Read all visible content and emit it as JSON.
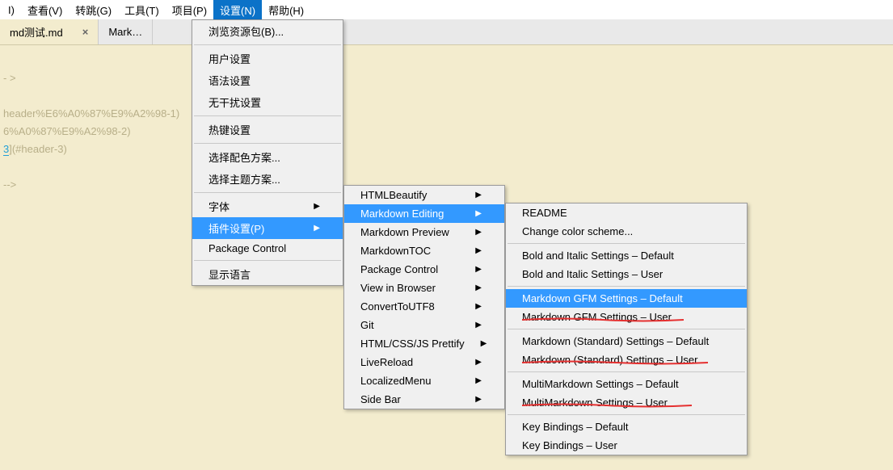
{
  "menubar": [
    {
      "label": "I)"
    },
    {
      "label": "查看(V)"
    },
    {
      "label": "转跳(G)"
    },
    {
      "label": "工具(T)"
    },
    {
      "label": "项目(P)"
    },
    {
      "label": "设置(N)",
      "active": true
    },
    {
      "label": "帮助(H)"
    }
  ],
  "tabs": [
    {
      "label": "md测试.md",
      "active": true,
      "close": "×"
    },
    {
      "label": "Mark…"
    }
  ],
  "editor": {
    "l1": "- >",
    "l2a": "header%E6%A0%87%E9%A2%98-1)",
    "l2b": "6%A0%87%E9%A2%98-2)",
    "l3_pre": "3",
    "l3_link": "](#header-3)",
    "l4": "-->"
  },
  "menu1": [
    {
      "type": "item",
      "label": "浏览资源包(B)..."
    },
    {
      "type": "sep"
    },
    {
      "type": "item",
      "label": "用户设置"
    },
    {
      "type": "item",
      "label": "语法设置"
    },
    {
      "type": "item",
      "label": "无干扰设置"
    },
    {
      "type": "sep"
    },
    {
      "type": "item",
      "label": "热键设置"
    },
    {
      "type": "sep"
    },
    {
      "type": "item",
      "label": "选择配色方案..."
    },
    {
      "type": "item",
      "label": "选择主题方案..."
    },
    {
      "type": "sep"
    },
    {
      "type": "item",
      "label": "字体",
      "sub": true
    },
    {
      "type": "item",
      "label": "插件设置(P)",
      "sub": true,
      "hi": true
    },
    {
      "type": "item",
      "label": "Package Control"
    },
    {
      "type": "sep"
    },
    {
      "type": "item",
      "label": "显示语言"
    }
  ],
  "menu2": [
    {
      "type": "item",
      "label": "HTMLBeautify",
      "sub": true
    },
    {
      "type": "item",
      "label": "Markdown Editing",
      "sub": true,
      "hi": true
    },
    {
      "type": "item",
      "label": "Markdown Preview",
      "sub": true
    },
    {
      "type": "item",
      "label": "MarkdownTOC",
      "sub": true
    },
    {
      "type": "item",
      "label": "Package Control",
      "sub": true
    },
    {
      "type": "item",
      "label": "View in Browser",
      "sub": true
    },
    {
      "type": "item",
      "label": "ConvertToUTF8",
      "sub": true
    },
    {
      "type": "item",
      "label": "Git",
      "sub": true
    },
    {
      "type": "item",
      "label": "HTML/CSS/JS Prettify",
      "sub": true
    },
    {
      "type": "item",
      "label": "LiveReload",
      "sub": true
    },
    {
      "type": "item",
      "label": "LocalizedMenu",
      "sub": true
    },
    {
      "type": "item",
      "label": "Side Bar",
      "sub": true
    }
  ],
  "menu3": [
    {
      "type": "item",
      "label": "README"
    },
    {
      "type": "item",
      "label": "Change color scheme..."
    },
    {
      "type": "sep"
    },
    {
      "type": "item",
      "label": "Bold and Italic Settings – Default"
    },
    {
      "type": "item",
      "label": "Bold and Italic Settings – User"
    },
    {
      "type": "sep"
    },
    {
      "type": "item",
      "label": "Markdown GFM Settings – Default",
      "hi": true
    },
    {
      "type": "item",
      "label": "Markdown GFM Settings – User"
    },
    {
      "type": "sep"
    },
    {
      "type": "item",
      "label": "Markdown (Standard) Settings – Default"
    },
    {
      "type": "item",
      "label": "Markdown (Standard) Settings – User"
    },
    {
      "type": "sep"
    },
    {
      "type": "item",
      "label": "MultiMarkdown Settings – Default"
    },
    {
      "type": "item",
      "label": "MultiMarkdown Settings – User"
    },
    {
      "type": "sep"
    },
    {
      "type": "item",
      "label": "Key Bindings – Default"
    },
    {
      "type": "item",
      "label": "Key Bindings – User"
    }
  ]
}
